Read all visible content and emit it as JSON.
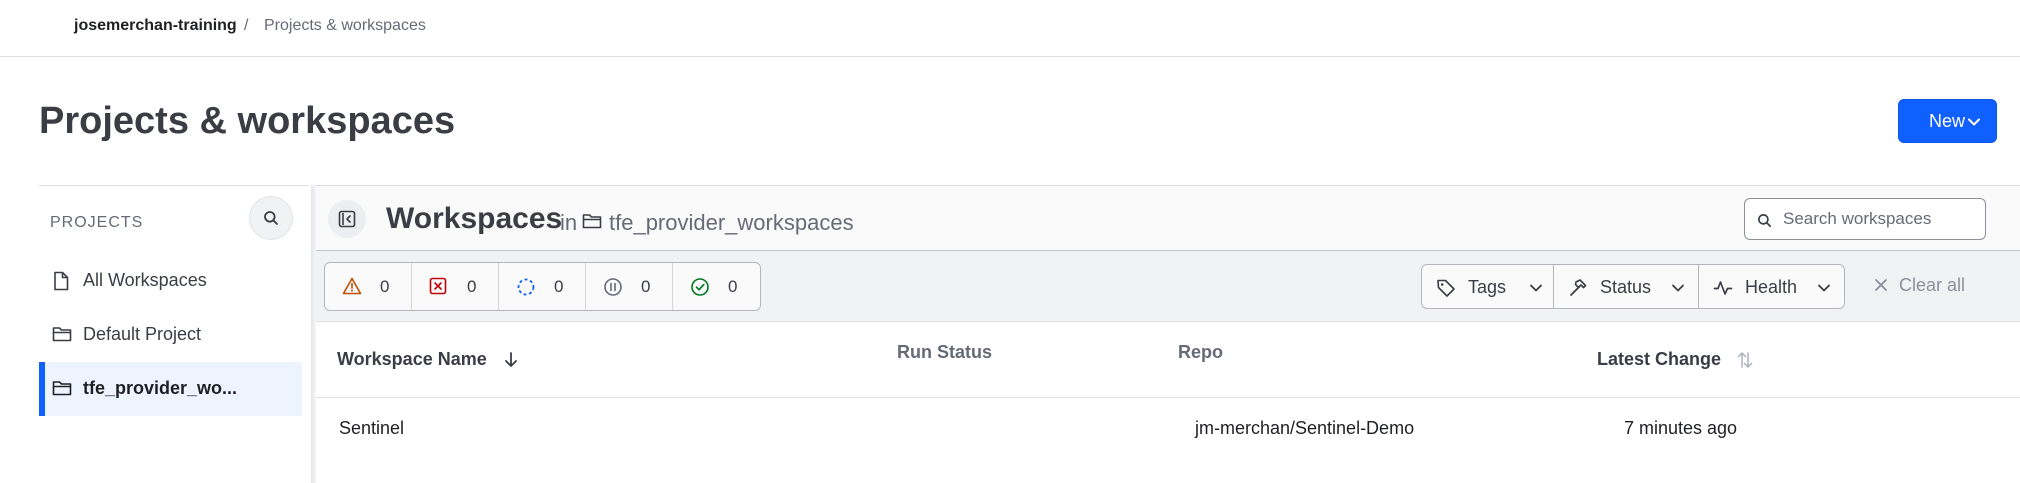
{
  "breadcrumb": {
    "org": "josemerchan-training",
    "separator": "/",
    "current": "Projects & workspaces"
  },
  "page": {
    "title": "Projects & workspaces",
    "new_button": "New"
  },
  "sidebar": {
    "header": "PROJECTS",
    "items": [
      {
        "label": "All Workspaces",
        "icon": "file-icon"
      },
      {
        "label": "Default Project",
        "icon": "folder-icon"
      },
      {
        "label": "tfe_provider_wo...",
        "icon": "folder-icon",
        "active": true
      }
    ]
  },
  "workspaces": {
    "title": "Workspaces",
    "in_word": "in",
    "project": "tfe_provider_workspaces",
    "search_placeholder": "Search workspaces"
  },
  "status_counts": [
    {
      "name": "warning",
      "icon": "warning-triangle-icon",
      "count": "0",
      "color": "#c04c04"
    },
    {
      "name": "errored",
      "icon": "x-square-icon",
      "count": "0",
      "color": "#c00005"
    },
    {
      "name": "running",
      "icon": "loading-icon",
      "count": "0",
      "color": "#1060ff"
    },
    {
      "name": "paused",
      "icon": "pause-circle-icon",
      "count": "0",
      "color": "#656a76"
    },
    {
      "name": "applied",
      "icon": "check-circle-icon",
      "count": "0",
      "color": "#00781e"
    }
  ],
  "filters": {
    "tags": "Tags",
    "status": "Status",
    "health": "Health",
    "clear_all": "Clear all"
  },
  "table": {
    "columns": {
      "name": "Workspace Name",
      "run_status": "Run Status",
      "repo": "Repo",
      "latest_change": "Latest Change"
    },
    "rows": [
      {
        "name": "Sentinel",
        "run_status": "",
        "repo": "jm-merchan/Sentinel-Demo",
        "latest_change": "7 minutes ago"
      }
    ]
  },
  "colors": {
    "accent": "#1060ff",
    "text": "#3b3d45",
    "muted": "#656a76"
  }
}
